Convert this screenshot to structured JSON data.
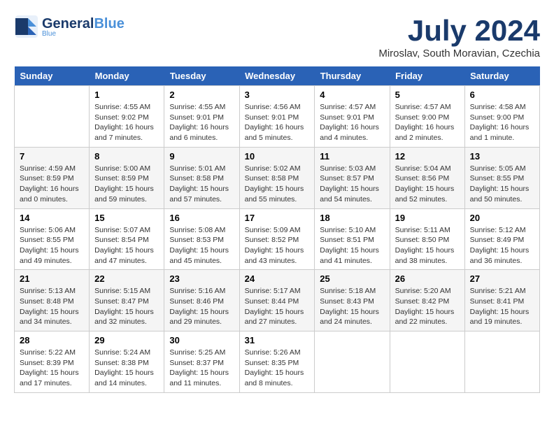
{
  "header": {
    "logo_general": "General",
    "logo_blue": "Blue",
    "month": "July 2024",
    "location": "Miroslav, South Moravian, Czechia"
  },
  "weekdays": [
    "Sunday",
    "Monday",
    "Tuesday",
    "Wednesday",
    "Thursday",
    "Friday",
    "Saturday"
  ],
  "weeks": [
    [
      {
        "day": "",
        "info": ""
      },
      {
        "day": "1",
        "info": "Sunrise: 4:55 AM\nSunset: 9:02 PM\nDaylight: 16 hours\nand 7 minutes."
      },
      {
        "day": "2",
        "info": "Sunrise: 4:55 AM\nSunset: 9:01 PM\nDaylight: 16 hours\nand 6 minutes."
      },
      {
        "day": "3",
        "info": "Sunrise: 4:56 AM\nSunset: 9:01 PM\nDaylight: 16 hours\nand 5 minutes."
      },
      {
        "day": "4",
        "info": "Sunrise: 4:57 AM\nSunset: 9:01 PM\nDaylight: 16 hours\nand 4 minutes."
      },
      {
        "day": "5",
        "info": "Sunrise: 4:57 AM\nSunset: 9:00 PM\nDaylight: 16 hours\nand 2 minutes."
      },
      {
        "day": "6",
        "info": "Sunrise: 4:58 AM\nSunset: 9:00 PM\nDaylight: 16 hours\nand 1 minute."
      }
    ],
    [
      {
        "day": "7",
        "info": "Sunrise: 4:59 AM\nSunset: 8:59 PM\nDaylight: 16 hours\nand 0 minutes."
      },
      {
        "day": "8",
        "info": "Sunrise: 5:00 AM\nSunset: 8:59 PM\nDaylight: 15 hours\nand 59 minutes."
      },
      {
        "day": "9",
        "info": "Sunrise: 5:01 AM\nSunset: 8:58 PM\nDaylight: 15 hours\nand 57 minutes."
      },
      {
        "day": "10",
        "info": "Sunrise: 5:02 AM\nSunset: 8:58 PM\nDaylight: 15 hours\nand 55 minutes."
      },
      {
        "day": "11",
        "info": "Sunrise: 5:03 AM\nSunset: 8:57 PM\nDaylight: 15 hours\nand 54 minutes."
      },
      {
        "day": "12",
        "info": "Sunrise: 5:04 AM\nSunset: 8:56 PM\nDaylight: 15 hours\nand 52 minutes."
      },
      {
        "day": "13",
        "info": "Sunrise: 5:05 AM\nSunset: 8:55 PM\nDaylight: 15 hours\nand 50 minutes."
      }
    ],
    [
      {
        "day": "14",
        "info": "Sunrise: 5:06 AM\nSunset: 8:55 PM\nDaylight: 15 hours\nand 49 minutes."
      },
      {
        "day": "15",
        "info": "Sunrise: 5:07 AM\nSunset: 8:54 PM\nDaylight: 15 hours\nand 47 minutes."
      },
      {
        "day": "16",
        "info": "Sunrise: 5:08 AM\nSunset: 8:53 PM\nDaylight: 15 hours\nand 45 minutes."
      },
      {
        "day": "17",
        "info": "Sunrise: 5:09 AM\nSunset: 8:52 PM\nDaylight: 15 hours\nand 43 minutes."
      },
      {
        "day": "18",
        "info": "Sunrise: 5:10 AM\nSunset: 8:51 PM\nDaylight: 15 hours\nand 41 minutes."
      },
      {
        "day": "19",
        "info": "Sunrise: 5:11 AM\nSunset: 8:50 PM\nDaylight: 15 hours\nand 38 minutes."
      },
      {
        "day": "20",
        "info": "Sunrise: 5:12 AM\nSunset: 8:49 PM\nDaylight: 15 hours\nand 36 minutes."
      }
    ],
    [
      {
        "day": "21",
        "info": "Sunrise: 5:13 AM\nSunset: 8:48 PM\nDaylight: 15 hours\nand 34 minutes."
      },
      {
        "day": "22",
        "info": "Sunrise: 5:15 AM\nSunset: 8:47 PM\nDaylight: 15 hours\nand 32 minutes."
      },
      {
        "day": "23",
        "info": "Sunrise: 5:16 AM\nSunset: 8:46 PM\nDaylight: 15 hours\nand 29 minutes."
      },
      {
        "day": "24",
        "info": "Sunrise: 5:17 AM\nSunset: 8:44 PM\nDaylight: 15 hours\nand 27 minutes."
      },
      {
        "day": "25",
        "info": "Sunrise: 5:18 AM\nSunset: 8:43 PM\nDaylight: 15 hours\nand 24 minutes."
      },
      {
        "day": "26",
        "info": "Sunrise: 5:20 AM\nSunset: 8:42 PM\nDaylight: 15 hours\nand 22 minutes."
      },
      {
        "day": "27",
        "info": "Sunrise: 5:21 AM\nSunset: 8:41 PM\nDaylight: 15 hours\nand 19 minutes."
      }
    ],
    [
      {
        "day": "28",
        "info": "Sunrise: 5:22 AM\nSunset: 8:39 PM\nDaylight: 15 hours\nand 17 minutes."
      },
      {
        "day": "29",
        "info": "Sunrise: 5:24 AM\nSunset: 8:38 PM\nDaylight: 15 hours\nand 14 minutes."
      },
      {
        "day": "30",
        "info": "Sunrise: 5:25 AM\nSunset: 8:37 PM\nDaylight: 15 hours\nand 11 minutes."
      },
      {
        "day": "31",
        "info": "Sunrise: 5:26 AM\nSunset: 8:35 PM\nDaylight: 15 hours\nand 8 minutes."
      },
      {
        "day": "",
        "info": ""
      },
      {
        "day": "",
        "info": ""
      },
      {
        "day": "",
        "info": ""
      }
    ]
  ]
}
